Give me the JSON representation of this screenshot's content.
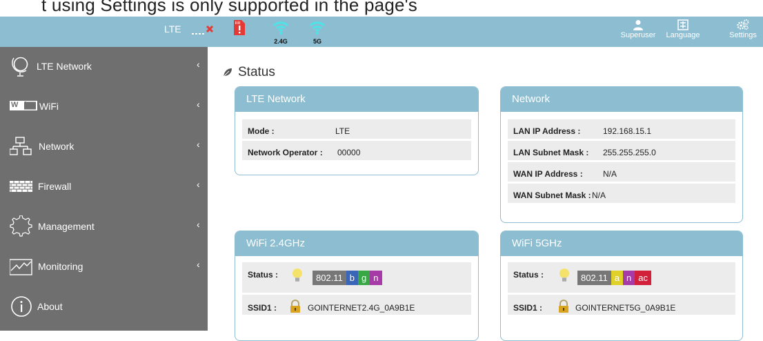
{
  "caption": "t using Settings is only supported in the page's",
  "header": {
    "lte_label": "LTE",
    "wifi24_label": "2.4G",
    "wifi5_label": "5G",
    "superuser_label": "Superuser",
    "language_label": "Language",
    "settings_label": "Settings",
    "icons": [
      "signal-disconnected-icon",
      "sim-card-icon",
      "wifi-icon",
      "user-icon",
      "language-icon",
      "gears-icon"
    ],
    "colors": {
      "header_bg": "#8cbdd1",
      "sim_red": "#e53935",
      "wifi_cyan": "#4fe3e8",
      "error_red": "#e53935"
    }
  },
  "sidebar": {
    "items": [
      {
        "label": "LTE Network",
        "icon": "globe-icon",
        "chevron": "‹"
      },
      {
        "label": "WiFi",
        "icon": "wifi-logo-icon",
        "chevron": "‹"
      },
      {
        "label": "Network",
        "icon": "network-icon",
        "chevron": "‹"
      },
      {
        "label": "Firewall",
        "icon": "firewall-icon",
        "chevron": "‹"
      },
      {
        "label": "Management",
        "icon": "gear-outline-icon",
        "chevron": "‹"
      },
      {
        "label": "Monitoring",
        "icon": "chart-icon",
        "chevron": "‹"
      },
      {
        "label": "About",
        "icon": "info-icon"
      }
    ],
    "wifi_logo_text": "Wi Fi"
  },
  "main": {
    "title": "Status",
    "lte_card": {
      "title": "LTE Network",
      "rows": [
        {
          "key": "Mode :",
          "value": "LTE"
        },
        {
          "key": "Network Operator :",
          "value": "00000"
        }
      ]
    },
    "network_card": {
      "title": "Network",
      "rows": [
        {
          "key": "LAN IP Address :",
          "value": "192.168.15.1"
        },
        {
          "key": "LAN Subnet Mask :",
          "value": "255.255.255.0"
        },
        {
          "key": "WAN IP Address :",
          "value": "N/A"
        },
        {
          "key": "WAN Subnet Mask :",
          "value": "N/A"
        }
      ]
    },
    "wifi24_card": {
      "title": "WiFi 2.4GHz",
      "status_key": "Status :",
      "mode_base": "802.11",
      "modes": [
        "b",
        "g",
        "n"
      ],
      "ssid_key": "SSID1 :",
      "ssid_value": "GOINTERNET2.4G_0A9B1E"
    },
    "wifi5_card": {
      "title": "WiFi 5GHz",
      "status_key": "Status :",
      "mode_base": "802.11",
      "modes": [
        "a",
        "n",
        "ac"
      ],
      "ssid_key": "SSID1 :",
      "ssid_value": "GOINTERNET5G_0A9B1E"
    }
  }
}
